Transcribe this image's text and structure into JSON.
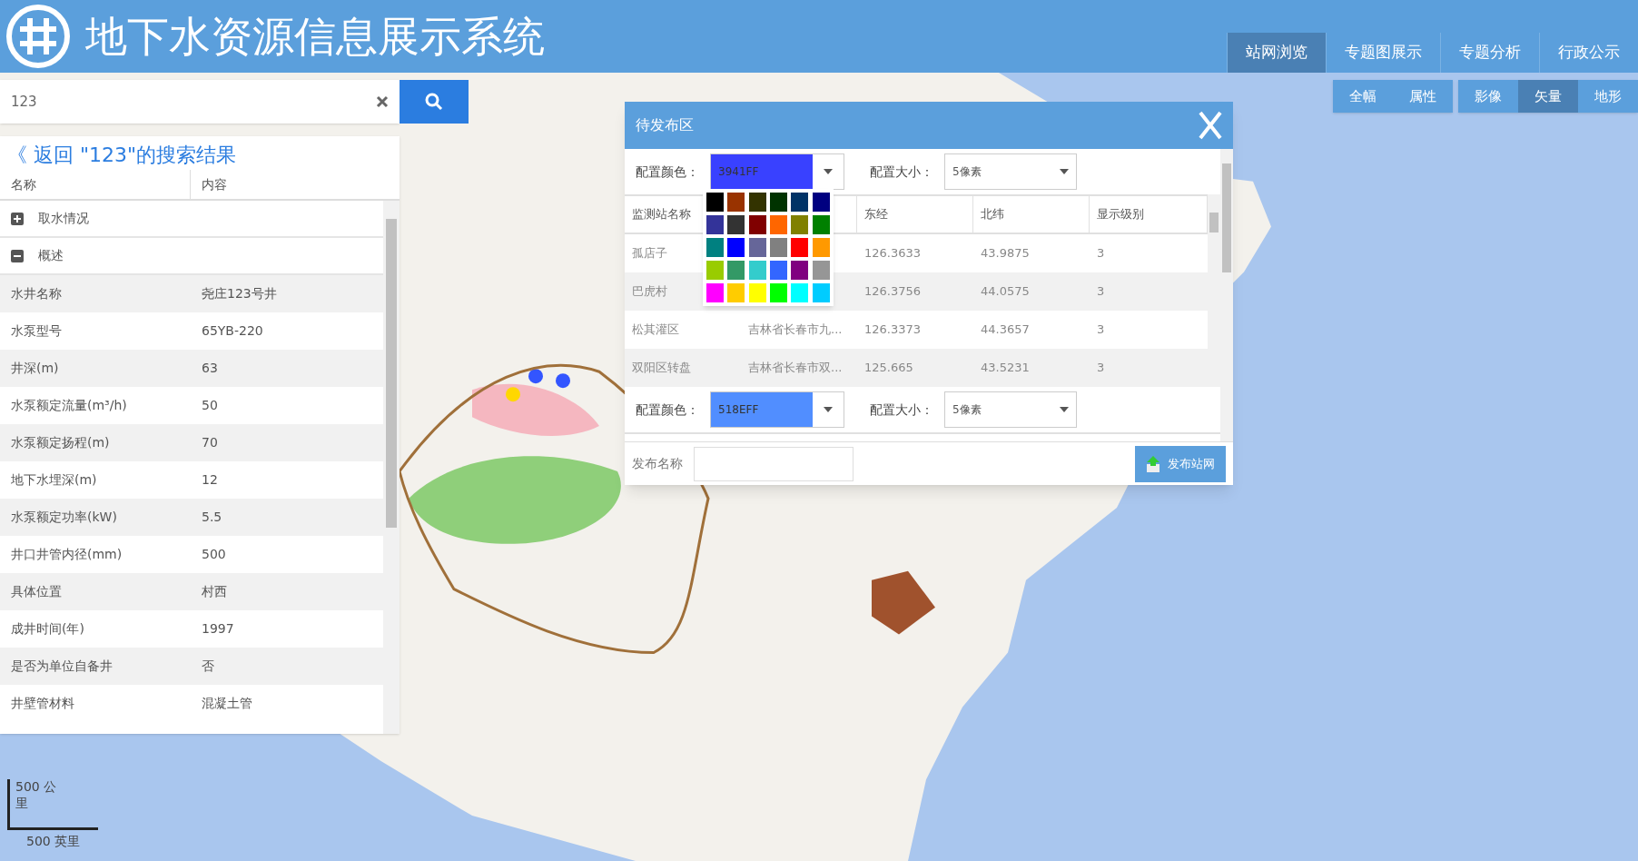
{
  "header": {
    "title": "地下水资源信息展示系统"
  },
  "nav_tabs": [
    {
      "label": "站网浏览",
      "selected": true
    },
    {
      "label": "专题图展示",
      "selected": false
    },
    {
      "label": "专题分析",
      "selected": false
    },
    {
      "label": "行政公示",
      "selected": false
    }
  ],
  "map_tools": [
    [
      {
        "label": "全幅",
        "selected": false
      },
      {
        "label": "属性",
        "selected": false
      }
    ],
    [
      {
        "label": "影像",
        "selected": false
      },
      {
        "label": "矢量",
        "selected": true
      },
      {
        "label": "地形",
        "selected": false
      }
    ]
  ],
  "search": {
    "value": "123"
  },
  "results": {
    "back_link": "《 返回 \"123\"的搜索结果",
    "columns": [
      "名称",
      "内容"
    ],
    "sections": [
      {
        "title": "取水情况",
        "expanded": false
      },
      {
        "title": "概述",
        "expanded": true
      }
    ],
    "rows": [
      [
        "水井名称",
        "尧庄123号井"
      ],
      [
        "水泵型号",
        "65YB-220"
      ],
      [
        "井深(m)",
        "63"
      ],
      [
        "水泵额定流量(m³/h)",
        "50"
      ],
      [
        "水泵额定扬程(m)",
        "70"
      ],
      [
        "地下水埋深(m)",
        "12"
      ],
      [
        "水泵额定功率(kW)",
        "5.5"
      ],
      [
        "井口井管内径(mm)",
        "500"
      ],
      [
        "具体位置",
        "村西"
      ],
      [
        "成井时间(年)",
        "1997"
      ],
      [
        "是否为单位自备井",
        "否"
      ],
      [
        "井壁管材料",
        "混凝土管"
      ]
    ]
  },
  "scale": {
    "metric": "500 公里",
    "imperial": "500 英里"
  },
  "dialog": {
    "title": "待发布区",
    "groups": [
      {
        "color_label": "配置颜色：",
        "color_value": "3941FF",
        "color": "#3941ff",
        "size_label": "配置大小：",
        "size_value": "5像素",
        "columns": [
          "监测站名称",
          null,
          "东经",
          "北纬",
          "显示级别"
        ],
        "rows": [
          [
            "孤店子",
            null,
            "126.3633",
            "43.9875",
            "3"
          ],
          [
            "巴虎村",
            null,
            "126.3756",
            "44.0575",
            "3"
          ],
          [
            "松其灌区",
            "吉林省长春市九...",
            "126.3373",
            "44.3657",
            "3"
          ],
          [
            "双阳区转盘",
            "吉林省长春市双...",
            "125.665",
            "43.5231",
            "3"
          ]
        ]
      },
      {
        "color_label": "配置颜色：",
        "color_value": "518EFF",
        "color": "#518eff",
        "size_label": "配置大小：",
        "size_value": "5像素"
      }
    ],
    "palette": [
      {
        "color": "#000000"
      },
      {
        "color": "#993300"
      },
      {
        "color": "#333300"
      },
      {
        "color": "#003300"
      },
      {
        "color": "#003366"
      },
      {
        "color": "#000080"
      },
      {
        "color": "#333399"
      },
      {
        "color": "#333333"
      },
      {
        "color": "#800000"
      },
      {
        "color": "#ff6600"
      },
      {
        "color": "#808000"
      },
      {
        "color": "#008000"
      },
      {
        "color": "#008080"
      },
      {
        "color": "#0000ff"
      },
      {
        "color": "#666699"
      },
      {
        "color": "#808080"
      },
      {
        "color": "#ff0000"
      },
      {
        "color": "#ff9900"
      },
      {
        "color": "#99cc00"
      },
      {
        "color": "#339966"
      },
      {
        "color": "#33cccc"
      },
      {
        "color": "#3366ff"
      },
      {
        "color": "#800080"
      },
      {
        "color": "#969696"
      },
      {
        "color": "#ff00ff"
      },
      {
        "color": "#ffcc00"
      },
      {
        "color": "#ffff00"
      },
      {
        "color": "#00ff00"
      },
      {
        "color": "#00ffff"
      },
      {
        "color": "#00ccff"
      }
    ],
    "publish_label": "发布名称",
    "publish_button": "发布站网"
  }
}
